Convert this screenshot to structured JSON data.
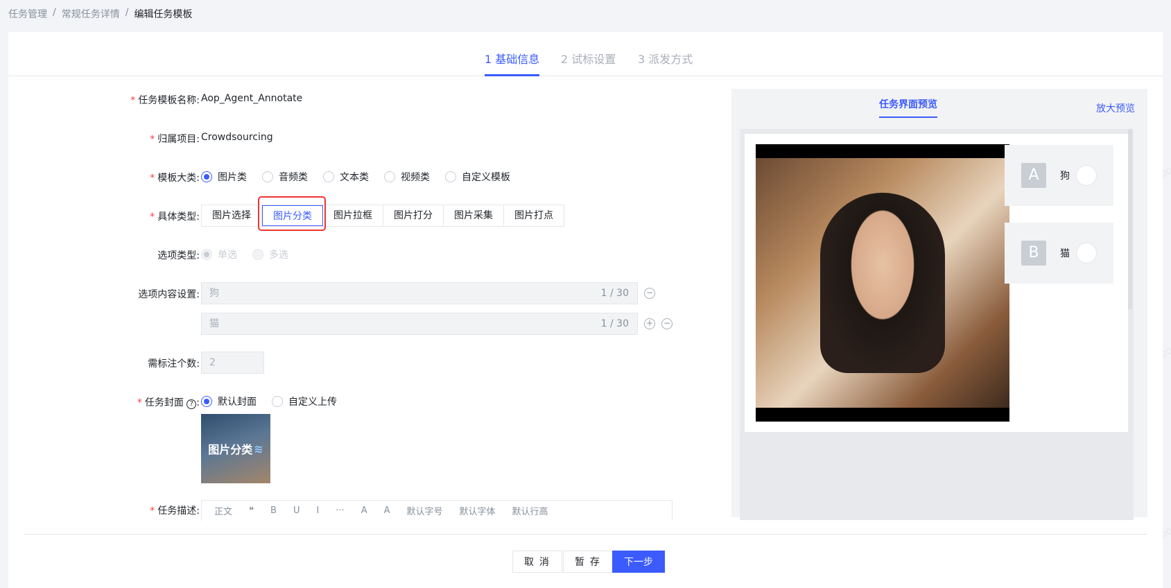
{
  "breadcrumb": {
    "items": [
      "任务管理",
      "常规任务详情",
      "编辑任务模板"
    ],
    "separator": "/"
  },
  "steps": [
    {
      "label": "1 基础信息",
      "active": true
    },
    {
      "label": "2 试标设置",
      "active": false
    },
    {
      "label": "3 派发方式",
      "active": false
    }
  ],
  "form": {
    "template_name": {
      "label": "任务模板名称:",
      "value": "Aop_Agent_Annotate"
    },
    "project": {
      "label": "归属项目:",
      "value": "Crowdsourcing"
    },
    "category": {
      "label": "模板大类:",
      "options": [
        "图片类",
        "音频类",
        "文本类",
        "视频类",
        "自定义模板"
      ],
      "selected": "图片类"
    },
    "type": {
      "label": "具体类型:",
      "options": [
        "图片选择",
        "图片分类",
        "图片拉框",
        "图片打分",
        "图片采集",
        "图片打点"
      ],
      "selected": "图片分类"
    },
    "option_type": {
      "label": "选项类型:",
      "options": [
        "单选",
        "多选"
      ],
      "selected": "单选"
    },
    "option_content": {
      "label": "选项内容设置:",
      "items": [
        {
          "placeholder": "狗",
          "count": "1 / 30"
        },
        {
          "placeholder": "猫",
          "count": "1 / 30"
        }
      ]
    },
    "annotation_count": {
      "label": "需标注个数:",
      "value": "2"
    },
    "cover": {
      "label": "任务封面",
      "label_suffix": ":",
      "options": [
        "默认封面",
        "自定义上传"
      ],
      "selected": "默认封面",
      "cover_text": "图片分类"
    },
    "description": {
      "label": "任务描述:",
      "toolbar": [
        "正文",
        "❝",
        "B",
        "U",
        "I",
        "···",
        "A",
        "A",
        "默认字号",
        "默认字体",
        "默认行高"
      ]
    }
  },
  "preview": {
    "title": "任务界面预览",
    "zoom_label": "放大预览",
    "options": [
      {
        "letter": "A",
        "label": "狗"
      },
      {
        "letter": "B",
        "label": "猫"
      }
    ]
  },
  "footer": {
    "cancel_label": "取 消",
    "save_label": "暂 存",
    "next_label": "下一步"
  },
  "watermark_text": "yangjingying01",
  "colors": {
    "primary": "#3b5bfd",
    "required": "#f53f3f",
    "highlight": "#e33333"
  }
}
